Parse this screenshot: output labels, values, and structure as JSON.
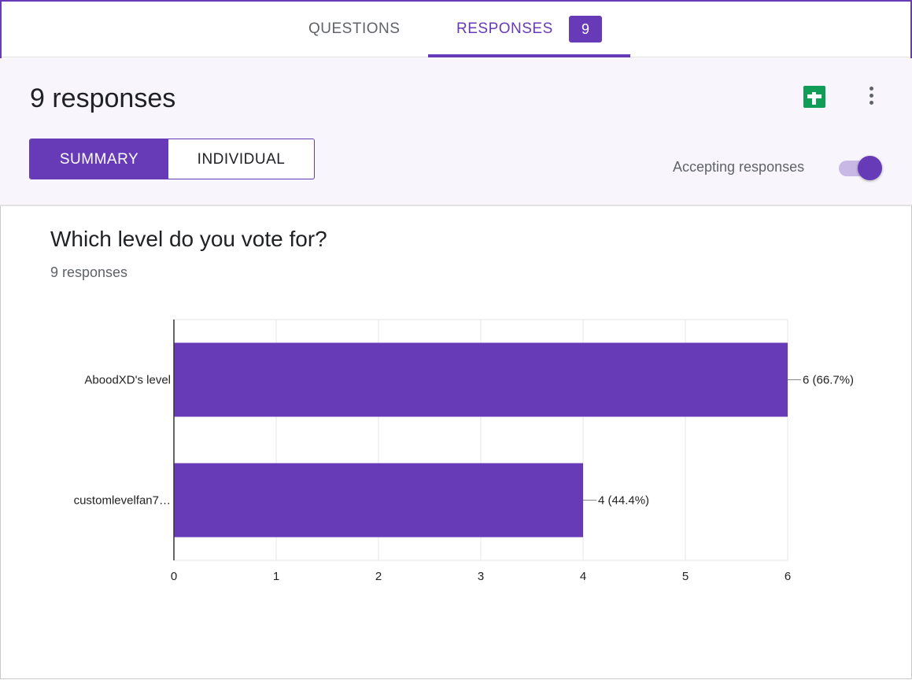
{
  "tabs": {
    "questions_label": "QUESTIONS",
    "responses_label": "RESPONSES",
    "responses_count": "9"
  },
  "summary": {
    "title": "9 responses",
    "summary_label": "SUMMARY",
    "individual_label": "INDIVIDUAL",
    "accepting_label": "Accepting responses",
    "accepting": true,
    "icons": [
      "sheets-icon",
      "more-vert-icon"
    ]
  },
  "question": {
    "title": "Which level do you vote for?",
    "subtitle": "9 responses"
  },
  "colors": {
    "accent": "#673ab7",
    "sheets": "#0f9d58"
  },
  "chart_data": {
    "type": "bar",
    "orientation": "horizontal",
    "categories": [
      "AboodXD's level",
      "customlevelfan7…"
    ],
    "values": [
      6,
      4
    ],
    "data_labels": [
      "6 (66.7%)",
      "4 (44.4%)"
    ],
    "xlim": [
      0,
      6
    ],
    "xticks": [
      "0",
      "1",
      "2",
      "3",
      "4",
      "5",
      "6"
    ],
    "grid": true,
    "bar_color": "#673ab7"
  }
}
